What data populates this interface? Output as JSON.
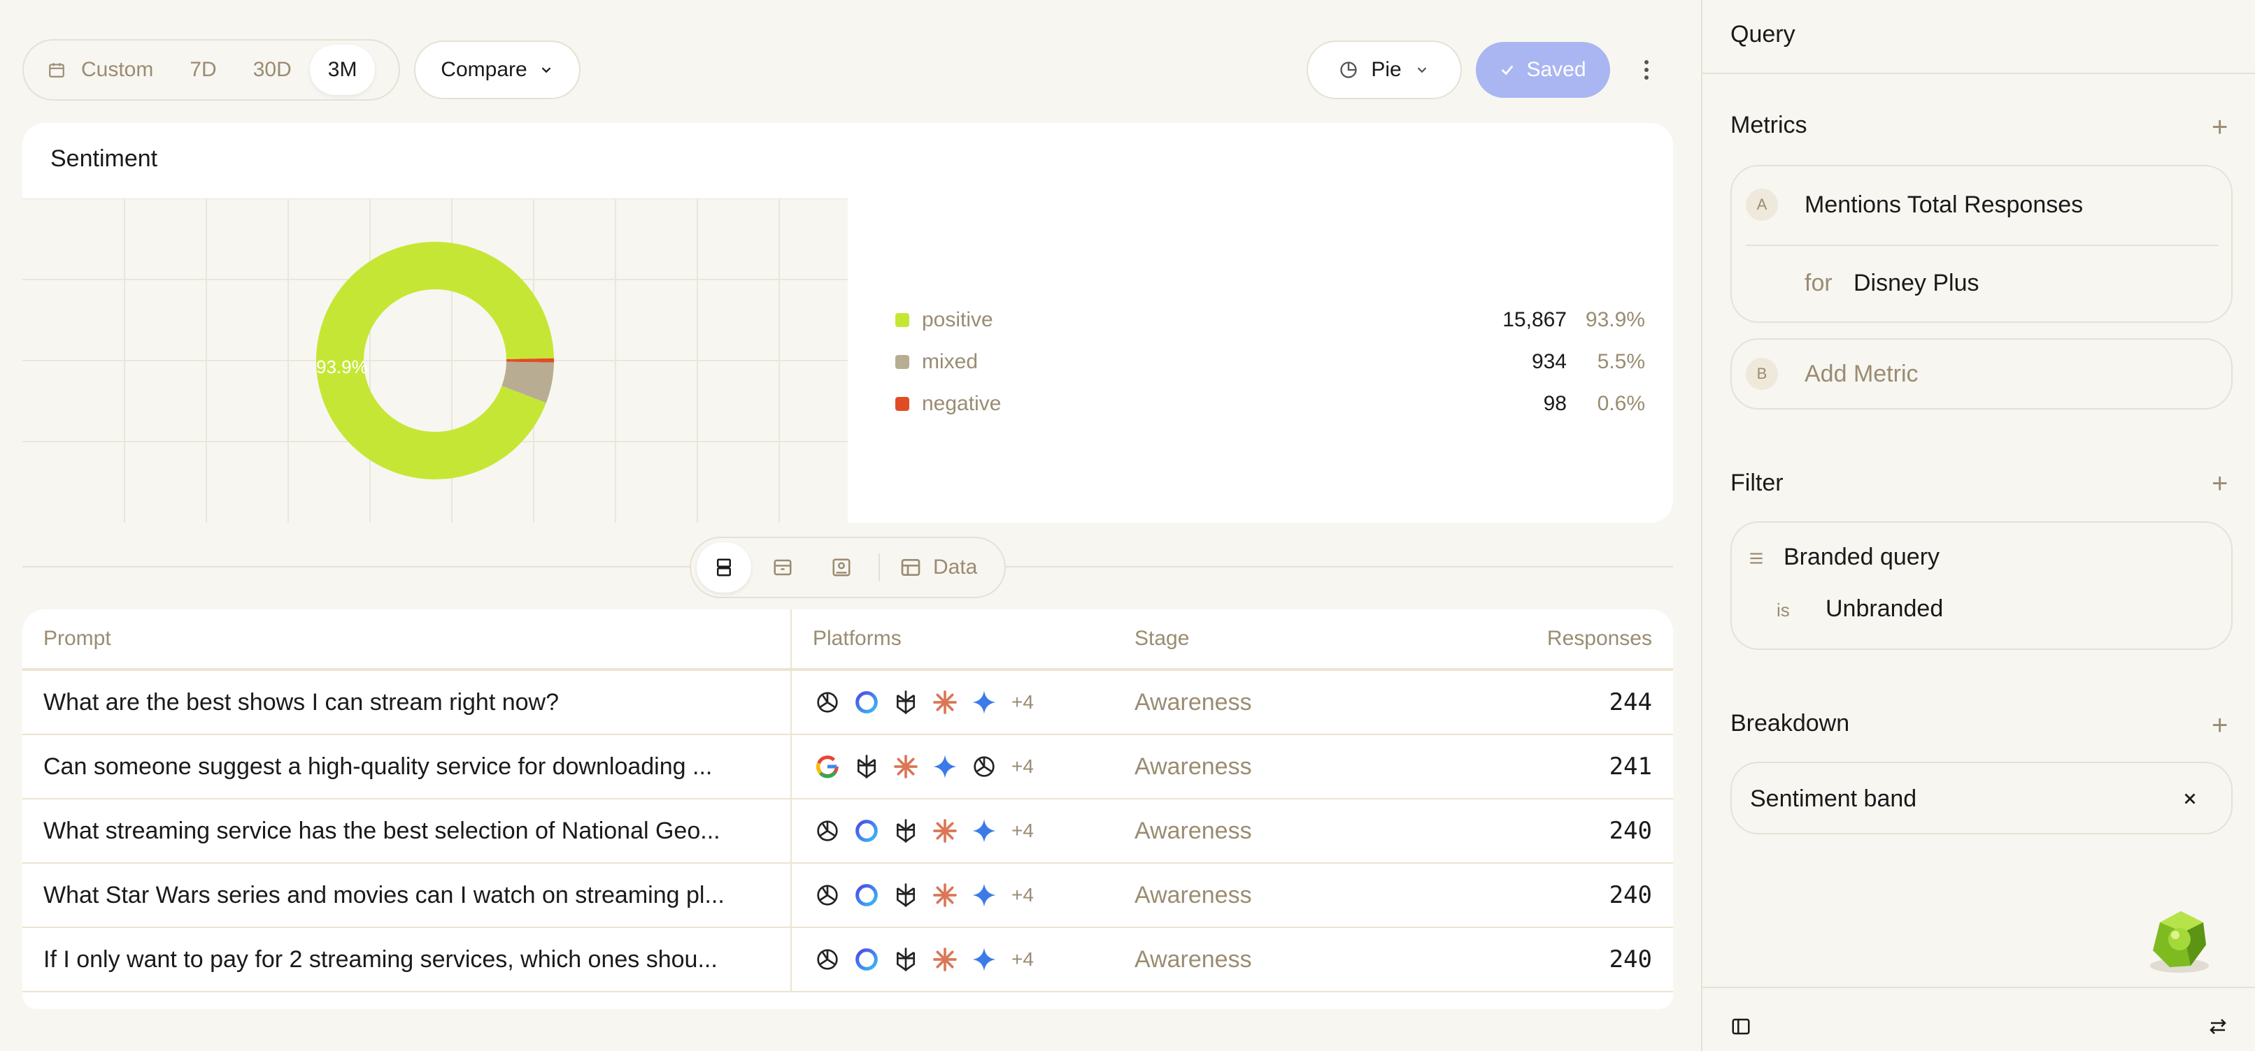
{
  "toolbar": {
    "range_options": [
      {
        "label": "Custom",
        "active": false
      },
      {
        "label": "7D",
        "active": false
      },
      {
        "label": "30D",
        "active": false
      },
      {
        "label": "3M",
        "active": true
      }
    ],
    "compare_label": "Compare",
    "chart_type_label": "Pie",
    "saved_label": "Saved"
  },
  "chart_card": {
    "title": "Sentiment",
    "center_label": "93.9%"
  },
  "chart_data": {
    "type": "pie",
    "title": "Sentiment",
    "donut": true,
    "labels": [
      "positive",
      "mixed",
      "negative"
    ],
    "values": [
      15867,
      934,
      98
    ],
    "percent": [
      93.9,
      5.5,
      0.6
    ],
    "colors": [
      "#c6e635",
      "#b8ad93",
      "#e04d25"
    ],
    "legend": [
      {
        "name": "positive",
        "count": "15,867",
        "pct": "93.9%",
        "color": "#c6e635"
      },
      {
        "name": "mixed",
        "count": "934",
        "pct": "5.5%",
        "color": "#b8ad93"
      },
      {
        "name": "negative",
        "count": "98",
        "pct": "0.6%",
        "color": "#e04d25"
      }
    ],
    "legend_position": "right"
  },
  "view_switch": {
    "data_label": "Data"
  },
  "table": {
    "headers": {
      "prompt": "Prompt",
      "platforms": "Platforms",
      "stage": "Stage",
      "responses": "Responses"
    },
    "rows": [
      {
        "prompt": "What are the best shows I can stream right now?",
        "platforms": [
          "openai-icon",
          "circle-icon",
          "perplexity-icon",
          "claude-icon",
          "gemini-icon"
        ],
        "more": "+4",
        "stage": "Awareness",
        "responses": "244"
      },
      {
        "prompt": "Can someone suggest a high-quality service for downloading ...",
        "platforms": [
          "google-icon",
          "perplexity-icon",
          "claude-icon",
          "gemini-icon",
          "openai-icon"
        ],
        "more": "+4",
        "stage": "Awareness",
        "responses": "241"
      },
      {
        "prompt": "What streaming service has the best selection of National Geo...",
        "platforms": [
          "openai-icon",
          "circle-icon",
          "perplexity-icon",
          "claude-icon",
          "gemini-icon"
        ],
        "more": "+4",
        "stage": "Awareness",
        "responses": "240"
      },
      {
        "prompt": "What Star Wars series and movies can I watch on streaming pl...",
        "platforms": [
          "openai-icon",
          "circle-icon",
          "perplexity-icon",
          "claude-icon",
          "gemini-icon"
        ],
        "more": "+4",
        "stage": "Awareness",
        "responses": "240"
      },
      {
        "prompt": "If I only want to pay for 2 streaming services, which ones shou...",
        "platforms": [
          "openai-icon",
          "circle-icon",
          "perplexity-icon",
          "claude-icon",
          "gemini-icon"
        ],
        "more": "+4",
        "stage": "Awareness",
        "responses": "240"
      }
    ]
  },
  "sidebar": {
    "title": "Query",
    "metrics": {
      "heading": "Metrics",
      "metric_a": {
        "letter": "A",
        "name": "Mentions Total Responses",
        "for_label": "for",
        "for_value": "Disney Plus"
      },
      "metric_b": {
        "letter": "B",
        "placeholder": "Add Metric"
      }
    },
    "filter": {
      "heading": "Filter",
      "field": "Branded query",
      "op": "is",
      "value": "Unbranded"
    },
    "breakdown": {
      "heading": "Breakdown",
      "value": "Sentiment band"
    }
  }
}
